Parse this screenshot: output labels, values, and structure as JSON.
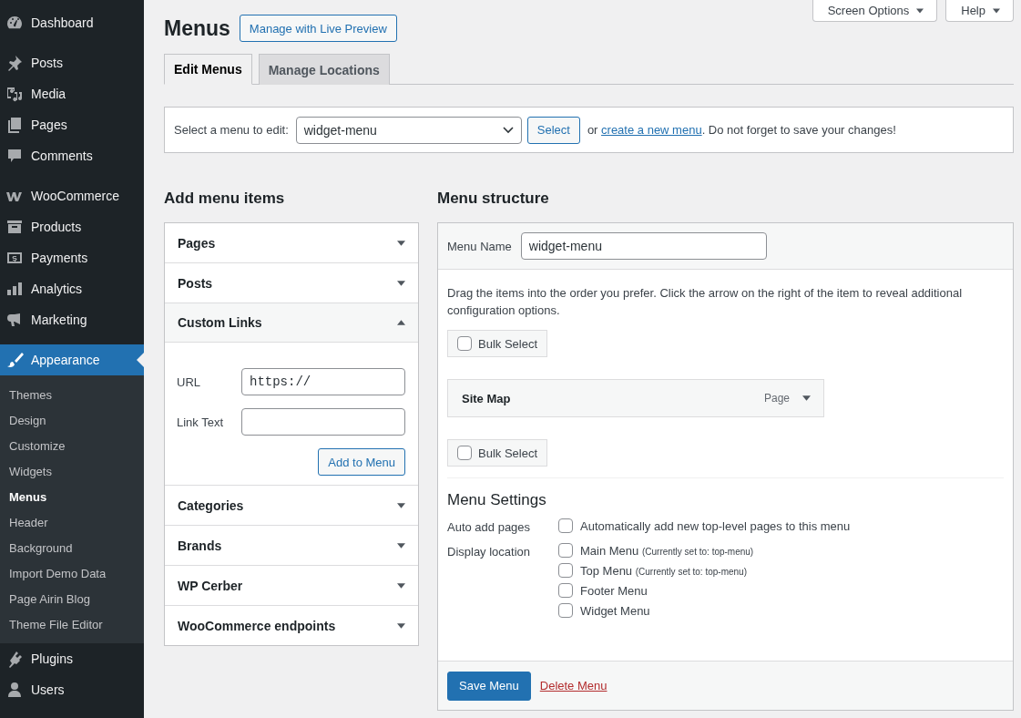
{
  "sidebar": {
    "sections": [
      [
        {
          "label": "Dashboard",
          "selected": false
        }
      ],
      [
        {
          "label": "Posts",
          "selected": false
        },
        {
          "label": "Media",
          "selected": false
        },
        {
          "label": "Pages",
          "selected": false
        },
        {
          "label": "Comments",
          "selected": false
        }
      ],
      [
        {
          "label": "WooCommerce",
          "selected": false
        },
        {
          "label": "Products",
          "selected": false
        },
        {
          "label": "Payments",
          "selected": false
        },
        {
          "label": "Analytics",
          "selected": false
        },
        {
          "label": "Marketing",
          "selected": false
        }
      ],
      [
        {
          "label": "Appearance",
          "selected": true,
          "children": [
            {
              "label": "Themes",
              "selected": false
            },
            {
              "label": "Design",
              "selected": false
            },
            {
              "label": "Customize",
              "selected": false
            },
            {
              "label": "Widgets",
              "selected": false
            },
            {
              "label": "Menus",
              "selected": true
            },
            {
              "label": "Header",
              "selected": false
            },
            {
              "label": "Background",
              "selected": false
            },
            {
              "label": "Import Demo Data",
              "selected": false
            },
            {
              "label": "Page Airin Blog",
              "selected": false
            },
            {
              "label": "Theme File Editor",
              "selected": false
            }
          ]
        },
        {
          "label": "Plugins",
          "selected": false
        },
        {
          "label": "Users",
          "selected": false
        }
      ]
    ]
  },
  "screen_links": [
    "Screen Options",
    "Help"
  ],
  "page": {
    "title": "Menus",
    "action": "Manage with Live Preview"
  },
  "tabs": [
    {
      "label": "Edit Menus",
      "selected": true
    },
    {
      "label": "Manage Locations",
      "selected": false
    }
  ],
  "select_bar": {
    "label": "Select a menu to edit:",
    "value": "widget-menu",
    "button": "Select",
    "before": "or",
    "link": "create a new menu",
    "after": ". Do not forget to save your changes!"
  },
  "add_items": {
    "heading": "Add menu items",
    "sections": [
      {
        "title": "Pages",
        "expanded": false
      },
      {
        "title": "Posts",
        "expanded": false
      },
      {
        "title": "Custom Links",
        "expanded": true,
        "fields": [
          {
            "label": "URL",
            "value": "https://"
          },
          {
            "label": "Link Text"
          }
        ],
        "button": "Add to Menu"
      },
      {
        "title": "Categories",
        "expanded": false
      },
      {
        "title": "Brands",
        "expanded": false
      },
      {
        "title": "WP Cerber",
        "expanded": false
      },
      {
        "title": "WooCommerce endpoints",
        "expanded": false
      }
    ]
  },
  "structure": {
    "heading": "Menu structure",
    "name_label": "Menu Name",
    "name_value": "widget-menu",
    "instructions": "Drag the items into the order you prefer. Click the arrow on the right of the item to reveal additional configuration options.",
    "bulk_top": {
      "label": "Bulk Select",
      "checked": false
    },
    "items": [
      {
        "title": "Site Map",
        "type": "Page"
      }
    ],
    "bulk_bottom": {
      "label": "Bulk Select",
      "checked": false
    },
    "settings": {
      "heading": "Menu Settings",
      "rows": [
        {
          "label": "Auto add pages",
          "options": [
            {
              "label": "Automatically add new top-level pages to this menu",
              "checked": false
            }
          ]
        },
        {
          "label": "Display location",
          "options": [
            {
              "label": "Main Menu",
              "note": "(Currently set to: top-menu)",
              "checked": false
            },
            {
              "label": "Top Menu",
              "note": "(Currently set to: top-menu)",
              "checked": false
            },
            {
              "label": "Footer Menu",
              "checked": false
            },
            {
              "label": "Widget Menu",
              "checked": false
            }
          ]
        }
      ]
    },
    "save": "Save Menu",
    "delete": "Delete Menu"
  }
}
